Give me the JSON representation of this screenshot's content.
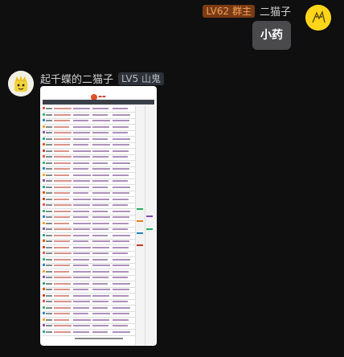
{
  "self": {
    "level_badge": "LV62 群主",
    "name": "二猫子",
    "message": "小药",
    "avatar_icon": "yellow-cartoon-avatar"
  },
  "other": {
    "name": "起千蝶的二猫子",
    "level_badge": "LV5 山鬼",
    "avatar_icon": "cartoon-character-avatar",
    "attachment": {
      "type": "image",
      "description_icon": "medicine-table-screenshot"
    }
  },
  "colors": {
    "background": "#0f0f10",
    "self_bubble": "#4a4a4c",
    "owner_badge_bg": "#7a3a14",
    "owner_badge_text": "#f0a25a",
    "member_badge_bg": "#2e3238"
  }
}
